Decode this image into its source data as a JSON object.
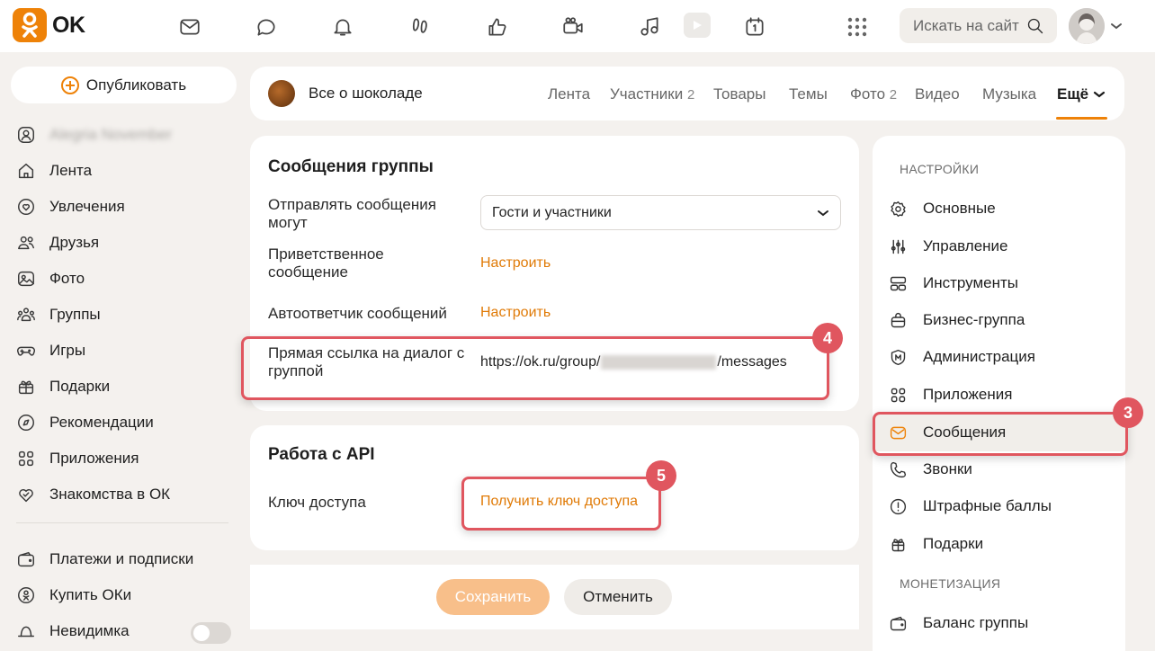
{
  "header": {
    "logo_text": "OK",
    "search_placeholder": "Искать на сайте",
    "icons": [
      "mail-icon",
      "discussions-icon",
      "bell-icon",
      "guests-icon",
      "likes-icon",
      "video-camera-icon",
      "music-icon",
      "video-icon",
      "calendar-icon"
    ]
  },
  "left_nav": {
    "publish_label": "Опубликовать",
    "profile_name": "Alegria November",
    "items": [
      {
        "label": "Лента",
        "icon": "home-icon"
      },
      {
        "label": "Увлечения",
        "icon": "hobbies-icon"
      },
      {
        "label": "Друзья",
        "icon": "friends-icon"
      },
      {
        "label": "Фото",
        "icon": "photo-icon"
      },
      {
        "label": "Группы",
        "icon": "groups-icon"
      },
      {
        "label": "Игры",
        "icon": "gamepad-icon"
      },
      {
        "label": "Подарки",
        "icon": "gift-icon"
      },
      {
        "label": "Рекомендации",
        "icon": "compass-icon"
      },
      {
        "label": "Приложения",
        "icon": "apps-icon"
      },
      {
        "label": "Знакомства в ОК",
        "icon": "dating-icon"
      }
    ],
    "payments_label": "Платежи и подписки",
    "buy_ok_label": "Купить ОКи",
    "invisible_label": "Невидимка"
  },
  "group": {
    "name": "Все о шоколаде",
    "tabs": [
      {
        "label": "Лента",
        "count": ""
      },
      {
        "label": "Участники",
        "count": "2"
      },
      {
        "label": "Товары",
        "count": ""
      },
      {
        "label": "Темы",
        "count": ""
      },
      {
        "label": "Фото",
        "count": "2"
      },
      {
        "label": "Видео",
        "count": ""
      },
      {
        "label": "Музыка",
        "count": ""
      },
      {
        "label": "Ещё",
        "count": ""
      }
    ]
  },
  "messages_card": {
    "title": "Сообщения группы",
    "send_label": "Отправлять сообщения могут",
    "send_value": "Гости и участники",
    "welcome_label": "Приветственное сообщение",
    "welcome_action": "Настроить",
    "autoreply_label": "Автоответчик сообщений",
    "autoreply_action": "Настроить",
    "direct_link_label": "Прямая ссылка на диалог с группой",
    "direct_link_prefix": "https://ok.ru/group/",
    "direct_link_suffix": "/messages"
  },
  "api_card": {
    "title": "Работа с API",
    "key_label": "Ключ доступа",
    "key_action": "Получить ключ доступа"
  },
  "actions": {
    "save": "Сохранить",
    "cancel": "Отменить"
  },
  "settings": {
    "heading": "НАСТРОЙКИ",
    "items": [
      {
        "label": "Основные",
        "icon": "gear-icon"
      },
      {
        "label": "Управление",
        "icon": "sliders-icon"
      },
      {
        "label": "Инструменты",
        "icon": "tools-icon"
      },
      {
        "label": "Бизнес-группа",
        "icon": "business-icon"
      },
      {
        "label": "Администрация",
        "icon": "shield-icon"
      },
      {
        "label": "Приложения",
        "icon": "apps-icon"
      },
      {
        "label": "Сообщения",
        "icon": "message-icon"
      },
      {
        "label": "Звонки",
        "icon": "phone-icon"
      },
      {
        "label": "Штрафные баллы",
        "icon": "warning-icon"
      },
      {
        "label": "Подарки",
        "icon": "gift-icon"
      }
    ],
    "monetization_heading": "МОНЕТИЗАЦИЯ",
    "balance_label": "Баланс группы"
  },
  "annotations": {
    "b3": "3",
    "b4": "4",
    "b5": "5"
  },
  "colors": {
    "accent": "#ee8208",
    "highlight": "#e0565f",
    "save_disabled": "#f8bf8a"
  }
}
